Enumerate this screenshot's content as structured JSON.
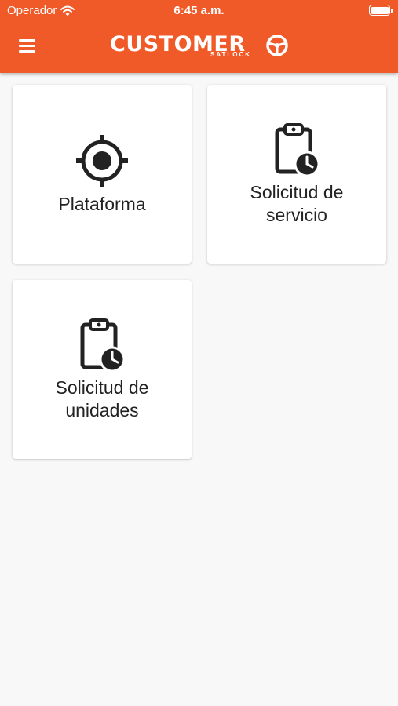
{
  "status_bar": {
    "carrier": "Operador",
    "time": "6:45 a.m."
  },
  "app_bar": {
    "logo_text": "CUSTOMER",
    "logo_subtext": "SATLOCK"
  },
  "cards": [
    {
      "label": "Plataforma",
      "icon": "crosshair-icon"
    },
    {
      "label": "Solicitud de servicio",
      "icon": "clipboard-clock-icon"
    },
    {
      "label": "Solicitud de unidades",
      "icon": "clipboard-clock-icon"
    }
  ],
  "colors": {
    "header": "#f05a28",
    "background": "#f8f8f8",
    "card": "#ffffff",
    "text": "#222222"
  }
}
